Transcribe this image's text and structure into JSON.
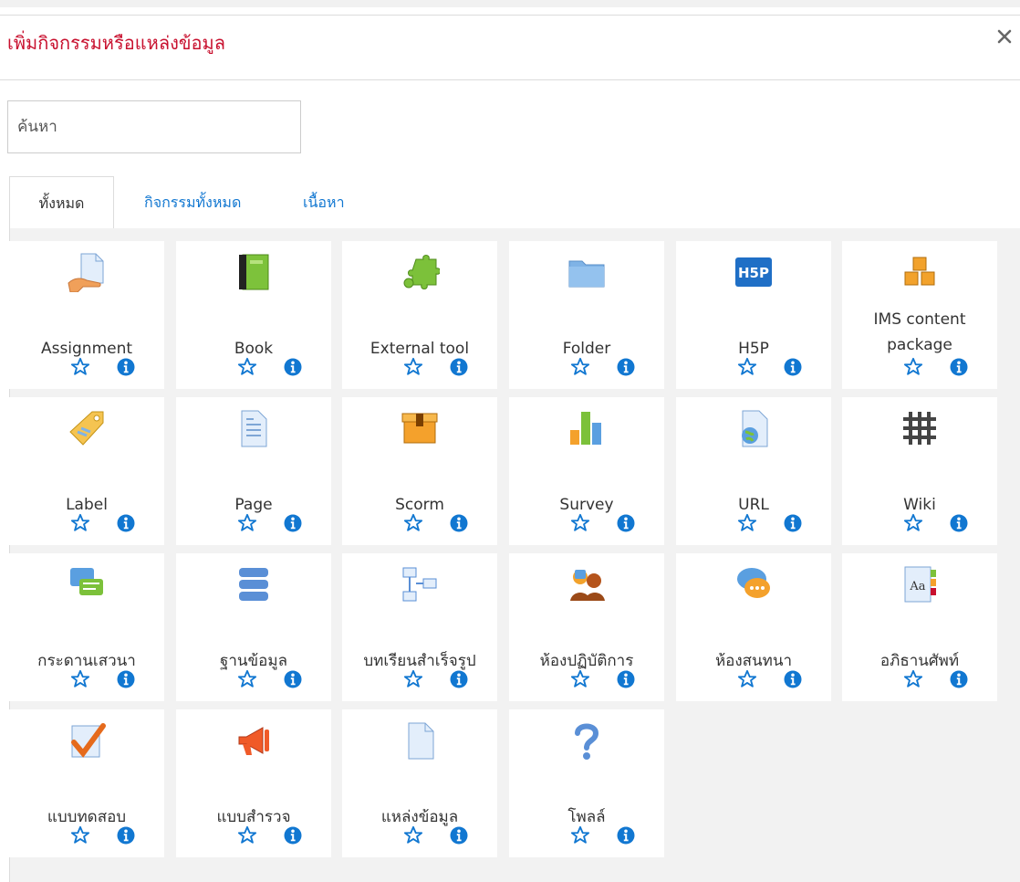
{
  "modal": {
    "title": "เพิ่มกิจกรรมหรือแหล่งข้อมูล",
    "close_label": "×"
  },
  "search": {
    "placeholder": "ค้นหา",
    "value": ""
  },
  "tabs": [
    {
      "label": "ทั้งหมด",
      "active": true
    },
    {
      "label": "กิจกรรมทั้งหมด",
      "active": false
    },
    {
      "label": "เนื้อหา",
      "active": false
    }
  ],
  "colors": {
    "title": "#c8102e",
    "link": "#1177d1",
    "star": "#1177d1",
    "info": "#1177d1"
  },
  "modules": [
    {
      "label": "Assignment",
      "icon": "assignment-icon"
    },
    {
      "label": "Book",
      "icon": "book-icon"
    },
    {
      "label": "External tool",
      "icon": "puzzle-icon"
    },
    {
      "label": "Folder",
      "icon": "folder-icon"
    },
    {
      "label": "H5P",
      "icon": "h5p-icon"
    },
    {
      "label": "IMS content package",
      "label_lines": [
        "IMS content",
        "package"
      ],
      "icon": "ims-package-icon"
    },
    {
      "label": "Label",
      "icon": "label-tag-icon"
    },
    {
      "label": "Page",
      "icon": "page-icon"
    },
    {
      "label": "Scorm",
      "icon": "scorm-box-icon"
    },
    {
      "label": "Survey",
      "icon": "survey-chart-icon"
    },
    {
      "label": "URL",
      "icon": "url-globe-icon"
    },
    {
      "label": "Wiki",
      "icon": "wiki-icon"
    },
    {
      "label": "กระดานเสวนา",
      "icon": "forum-icon"
    },
    {
      "label": "ฐานข้อมูล",
      "icon": "database-icon"
    },
    {
      "label": "บทเรียนสำเร็จรูป",
      "icon": "lesson-icon"
    },
    {
      "label": "ห้องปฏิบัติการ",
      "icon": "workshop-icon"
    },
    {
      "label": "ห้องสนทนา",
      "icon": "chat-icon"
    },
    {
      "label": "อภิธานศัพท์",
      "icon": "glossary-icon"
    },
    {
      "label": "แบบทดสอบ",
      "icon": "quiz-icon"
    },
    {
      "label": "แบบสำรวจ",
      "icon": "feedback-megaphone-icon"
    },
    {
      "label": "แหล่งข้อมูล",
      "icon": "resource-file-icon"
    },
    {
      "label": "โพลล์",
      "icon": "choice-question-icon"
    }
  ]
}
